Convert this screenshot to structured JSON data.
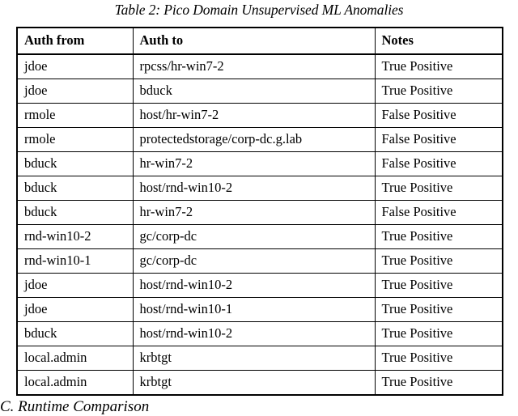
{
  "document": {
    "caption": "Table 2: Pico Domain Unsupervised ML Anomalies",
    "next_section_heading": "C.  Runtime Comparison"
  },
  "table": {
    "columns": [
      {
        "key": "auth_from",
        "label": "Auth from"
      },
      {
        "key": "auth_to",
        "label": "Auth to"
      },
      {
        "key": "notes",
        "label": "Notes"
      }
    ],
    "rows": [
      {
        "auth_from": "jdoe",
        "auth_to": "rpcss/hr-win7-2",
        "notes": "True Positive"
      },
      {
        "auth_from": "jdoe",
        "auth_to": "bduck",
        "notes": "True Positive"
      },
      {
        "auth_from": "rmole",
        "auth_to": "host/hr-win7-2",
        "notes": "False Positive"
      },
      {
        "auth_from": "rmole",
        "auth_to": "protectedstorage/corp-dc.g.lab",
        "notes": "False Positive"
      },
      {
        "auth_from": "bduck",
        "auth_to": "hr-win7-2",
        "notes": "False Positive"
      },
      {
        "auth_from": "bduck",
        "auth_to": "host/rnd-win10-2",
        "notes": "True Positive"
      },
      {
        "auth_from": "bduck",
        "auth_to": "hr-win7-2",
        "notes": "False Positive"
      },
      {
        "auth_from": "rnd-win10-2",
        "auth_to": "gc/corp-dc",
        "notes": "True Positive"
      },
      {
        "auth_from": "rnd-win10-1",
        "auth_to": "gc/corp-dc",
        "notes": "True Positive"
      },
      {
        "auth_from": "jdoe",
        "auth_to": "host/rnd-win10-2",
        "notes": "True Positive"
      },
      {
        "auth_from": "jdoe",
        "auth_to": "host/rnd-win10-1",
        "notes": "True Positive"
      },
      {
        "auth_from": "bduck",
        "auth_to": "host/rnd-win10-2",
        "notes": "True Positive"
      },
      {
        "auth_from": "local.admin",
        "auth_to": "krbtgt",
        "notes": "True Positive"
      },
      {
        "auth_from": "local.admin",
        "auth_to": "krbtgt",
        "notes": "True Positive"
      }
    ]
  },
  "colors": {
    "page_background": "#ffffff",
    "text": "#000000",
    "table_border": "#000000"
  }
}
